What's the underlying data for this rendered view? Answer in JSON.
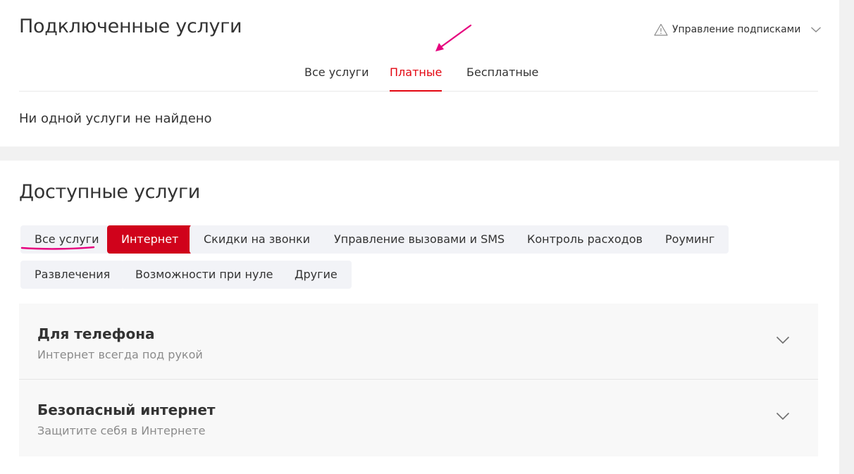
{
  "connected": {
    "title": "Подключенные услуги",
    "manage_subscriptions": {
      "label": "Управление подписками",
      "icon": "warning-icon"
    },
    "tabs": [
      {
        "label": "Все услуги",
        "active": false
      },
      {
        "label": "Платные",
        "active": true
      },
      {
        "label": "Бесплатные",
        "active": false
      }
    ],
    "empty_message": "Ни одной услуги не найдено"
  },
  "available": {
    "title": "Доступные услуги",
    "categories": [
      {
        "label": "Все услуги",
        "active": false
      },
      {
        "label": "Интернет",
        "active": true
      },
      {
        "label": "Скидки на звонки",
        "active": false
      },
      {
        "label": "Управление вызовами и SMS",
        "active": false
      },
      {
        "label": "Контроль расходов",
        "active": false
      },
      {
        "label": "Роуминг",
        "active": false
      },
      {
        "label": "Развлечения",
        "active": false
      },
      {
        "label": "Возможности при нуле",
        "active": false
      },
      {
        "label": "Другие",
        "active": false
      }
    ],
    "groups": [
      {
        "title": "Для телефона",
        "subtitle": "Интернет всегда под рукой"
      },
      {
        "title": "Безопасный интернет",
        "subtitle": "Защитите себя в Интернете"
      }
    ]
  },
  "colors": {
    "accent": "#e30611",
    "active_chip": "#d0021b",
    "chip_bg": "#f2f3f7",
    "annotation": "#e6007e"
  }
}
